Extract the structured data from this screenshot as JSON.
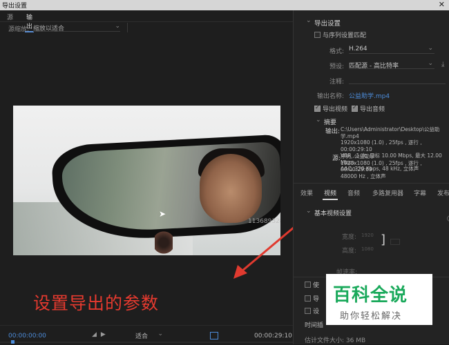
{
  "window": {
    "title": "导出设置",
    "close_glyph": "✕"
  },
  "left_tabs": [
    {
      "label": "源",
      "active": false
    },
    {
      "label": "输出",
      "active": true
    }
  ],
  "source_scaling": {
    "label": "源缩放:",
    "value": "缩放以适合"
  },
  "preview": {
    "watermark_text": "1136893289"
  },
  "annotation": {
    "text": "设置导出的参数",
    "color": "#e63a2f"
  },
  "timeline": {
    "timecode_in": "00:00:00:00",
    "timecode_out": "00:00:29:10",
    "fit_value": "适合",
    "accent": "#4d8ddb"
  },
  "export_settings": {
    "section_title": "导出设置",
    "match_sequence_label": "与序列设置匹配",
    "format_label": "格式:",
    "format_value": "H.264",
    "preset_label": "预设:",
    "preset_value": "匹配源 - 高比特率",
    "comment_label": "注释:",
    "output_name_label": "输出名称:",
    "output_name_value": "公益助学.mp4",
    "export_video_label": "导出视频",
    "export_audio_label": "导出音频",
    "summary_title": "摘要",
    "output_label": "输出:",
    "output_lines": [
      "C:\\Users\\Administrator\\Desktop\\公益助学.mp4",
      "1920x1080 (1.0) , 25fps , 逐行 , 00:00:29:10",
      "VBR , 1 次, 目标 10.00 Mbps, 最大 12.00 Mbps",
      "AAC, 320 Kbps, 48 kHz, 立体声"
    ],
    "source_label": "源:",
    "source_lines": [
      "序列, 公益助学",
      "1920x1080 (1.0) , 25fps , 逐行 , 00:00:29:09",
      "48000 Hz , 立体声"
    ]
  },
  "right_tabs": [
    {
      "label": "效果",
      "active": false
    },
    {
      "label": "视频",
      "active": true
    },
    {
      "label": "音频",
      "active": false
    },
    {
      "label": "多路复用器",
      "active": false
    },
    {
      "label": "字幕",
      "active": false
    },
    {
      "label": "发布",
      "active": false
    }
  ],
  "video_settings": {
    "section_title": "基本视频设置",
    "width_label": "宽度:",
    "width_value": "1920",
    "height_label": "高度:",
    "height_value": "1080",
    "frame_rate_label": "帧速率:"
  },
  "bottom_options": [
    {
      "label": "使"
    },
    {
      "label": "导"
    },
    {
      "label": "设"
    }
  ],
  "time_interp_label": "时间插",
  "estimated_size": "估计文件大小: 36 MB",
  "logo": {
    "title": "百科全说",
    "subtitle": "助你轻松解决",
    "color": "#1aa95b"
  }
}
